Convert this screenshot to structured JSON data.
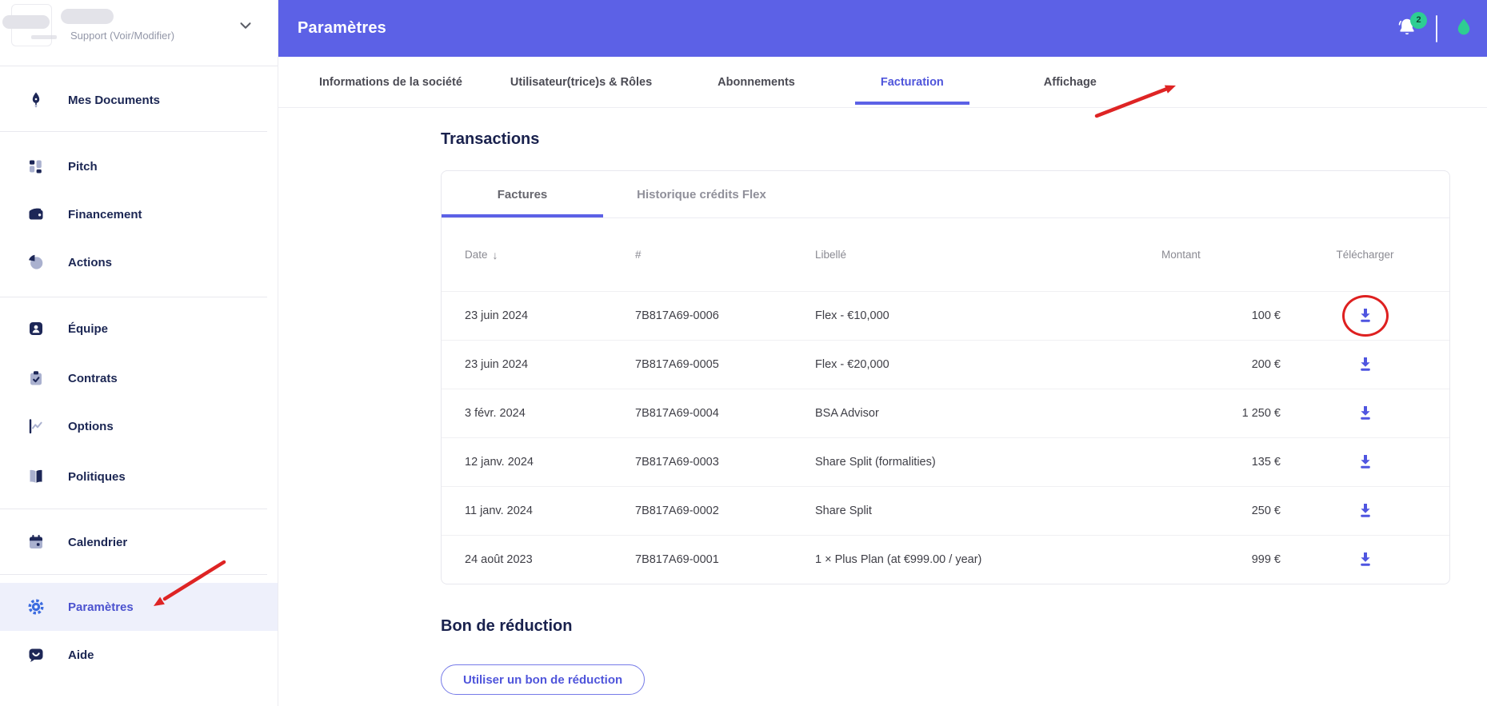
{
  "workspace": {
    "support_label": "Support (Voir/Modifier)"
  },
  "topbar": {
    "title": "Paramètres",
    "notification_count": "2"
  },
  "nav_tabs": {
    "items": [
      {
        "label": "Informations de la société",
        "active": false
      },
      {
        "label": "Utilisateur(trice)s & Rôles",
        "active": false
      },
      {
        "label": "Abonnements",
        "active": false
      },
      {
        "label": "Facturation",
        "active": true
      },
      {
        "label": "Affichage",
        "active": false
      }
    ]
  },
  "sidebar": {
    "items": [
      {
        "label": "Mes Documents"
      },
      {
        "label": "Pitch"
      },
      {
        "label": "Financement"
      },
      {
        "label": "Actions"
      },
      {
        "label": "Équipe"
      },
      {
        "label": "Contrats"
      },
      {
        "label": "Options"
      },
      {
        "label": "Politiques"
      },
      {
        "label": "Calendrier"
      },
      {
        "label": "Paramètres"
      },
      {
        "label": "Aide"
      }
    ]
  },
  "transactions": {
    "title": "Transactions",
    "tabs": [
      {
        "label": "Factures",
        "active": true
      },
      {
        "label": "Historique crédits Flex",
        "active": false
      }
    ],
    "table": {
      "headers": {
        "date": "Date",
        "number": "#",
        "label": "Libellé",
        "amount": "Montant",
        "download": "Télécharger"
      },
      "sort_indicator": "↓",
      "rows": [
        {
          "date": "23 juin 2024",
          "number": "7B817A69-0006",
          "label": "Flex - €10,000",
          "amount": "100 €"
        },
        {
          "date": "23 juin 2024",
          "number": "7B817A69-0005",
          "label": "Flex - €20,000",
          "amount": "200 €"
        },
        {
          "date": "3 févr. 2024",
          "number": "7B817A69-0004",
          "label": "BSA Advisor",
          "amount": "1 250 €"
        },
        {
          "date": "12 janv. 2024",
          "number": "7B817A69-0003",
          "label": "Share Split (formalities)",
          "amount": "135 €"
        },
        {
          "date": "11 janv. 2024",
          "number": "7B817A69-0002",
          "label": "Share Split",
          "amount": "250 €"
        },
        {
          "date": "24 août 2023",
          "number": "7B817A69-0001",
          "label": "1 × Plus Plan (at €999.00 / year)",
          "amount": "999 €"
        }
      ]
    }
  },
  "coupon": {
    "title": "Bon de réduction",
    "button_label": "Utiliser un bon de réduction"
  },
  "colors": {
    "accent": "#5c61e6",
    "active_link": "#4f55db",
    "navy": "#1b2653",
    "icon_gray": "#aab1cf",
    "badge_green": "#2dce93",
    "download_indigo": "#4f55e0",
    "annotation_red": "#de2020"
  }
}
